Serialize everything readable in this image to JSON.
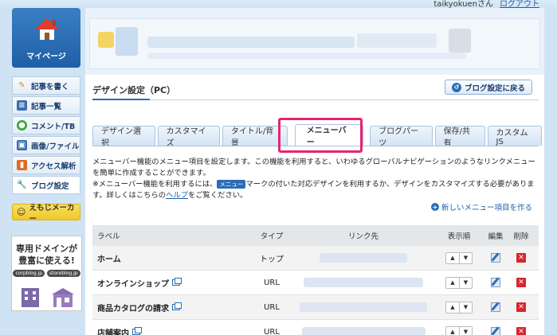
{
  "header": {
    "user_label": "taikyokuenさん",
    "logout": "ログアウト"
  },
  "sidebar": {
    "mypage": "マイページ",
    "items": [
      {
        "label": "記事を書く",
        "icon": "pencil-icon"
      },
      {
        "label": "記事一覧",
        "icon": "list-icon"
      },
      {
        "label": "コメント/TB",
        "icon": "comment-icon"
      },
      {
        "label": "画像/ファイル",
        "icon": "image-icon"
      },
      {
        "label": "アクセス解析",
        "icon": "chart-icon"
      },
      {
        "label": "ブログ設定",
        "icon": "wrench-icon"
      }
    ],
    "emoji_maker": "えもじメーカー",
    "domain_ad": {
      "line1": "専用ドメインが",
      "line2": "豊富に使える!",
      "pill1": "corpblog.jp",
      "pill2": "storeblog.jp"
    }
  },
  "page": {
    "title": "デザイン設定（PC）",
    "back_button": "ブログ設定に戻る",
    "tabs": [
      "デザイン選択",
      "カスタマイズ",
      "タイトル/背景",
      "メニューバー",
      "ブログパーツ",
      "保存/共有",
      "カスタムJS"
    ],
    "active_tab": 3,
    "desc1": "メニューバー機能のメニュー項目を設定します。この機能を利用すると、いわゆるグローバルナビゲーションのようなリンクメニューを簡単に作成することができます。",
    "desc2_a": "※メニューバー機能を利用するには、",
    "desc2_badge": "メニュー",
    "desc2_b": "マークの付いた対応デザインを利用するか、デザインをカスタマイズする必要があります。詳しくはこちらの",
    "desc2_link": "ヘルプ",
    "desc2_c": "をご覧ください。",
    "add_link": "新しいメニュー項目を作る"
  },
  "table": {
    "headers": {
      "label": "ラベル",
      "type": "タイプ",
      "link": "リンク先",
      "order": "表示順",
      "edit": "編集",
      "delete": "削除"
    },
    "rows": [
      {
        "label": "ホーム",
        "type": "トップ",
        "external": false
      },
      {
        "label": "オンラインショップ",
        "type": "URL",
        "external": true
      },
      {
        "label": "商品カタログの請求",
        "type": "URL",
        "external": true
      },
      {
        "label": "店舗案内",
        "type": "URL",
        "external": true
      }
    ]
  },
  "colors": {
    "accent": "#2a6db5",
    "highlight": "#e52670",
    "delete": "#d9262c"
  }
}
